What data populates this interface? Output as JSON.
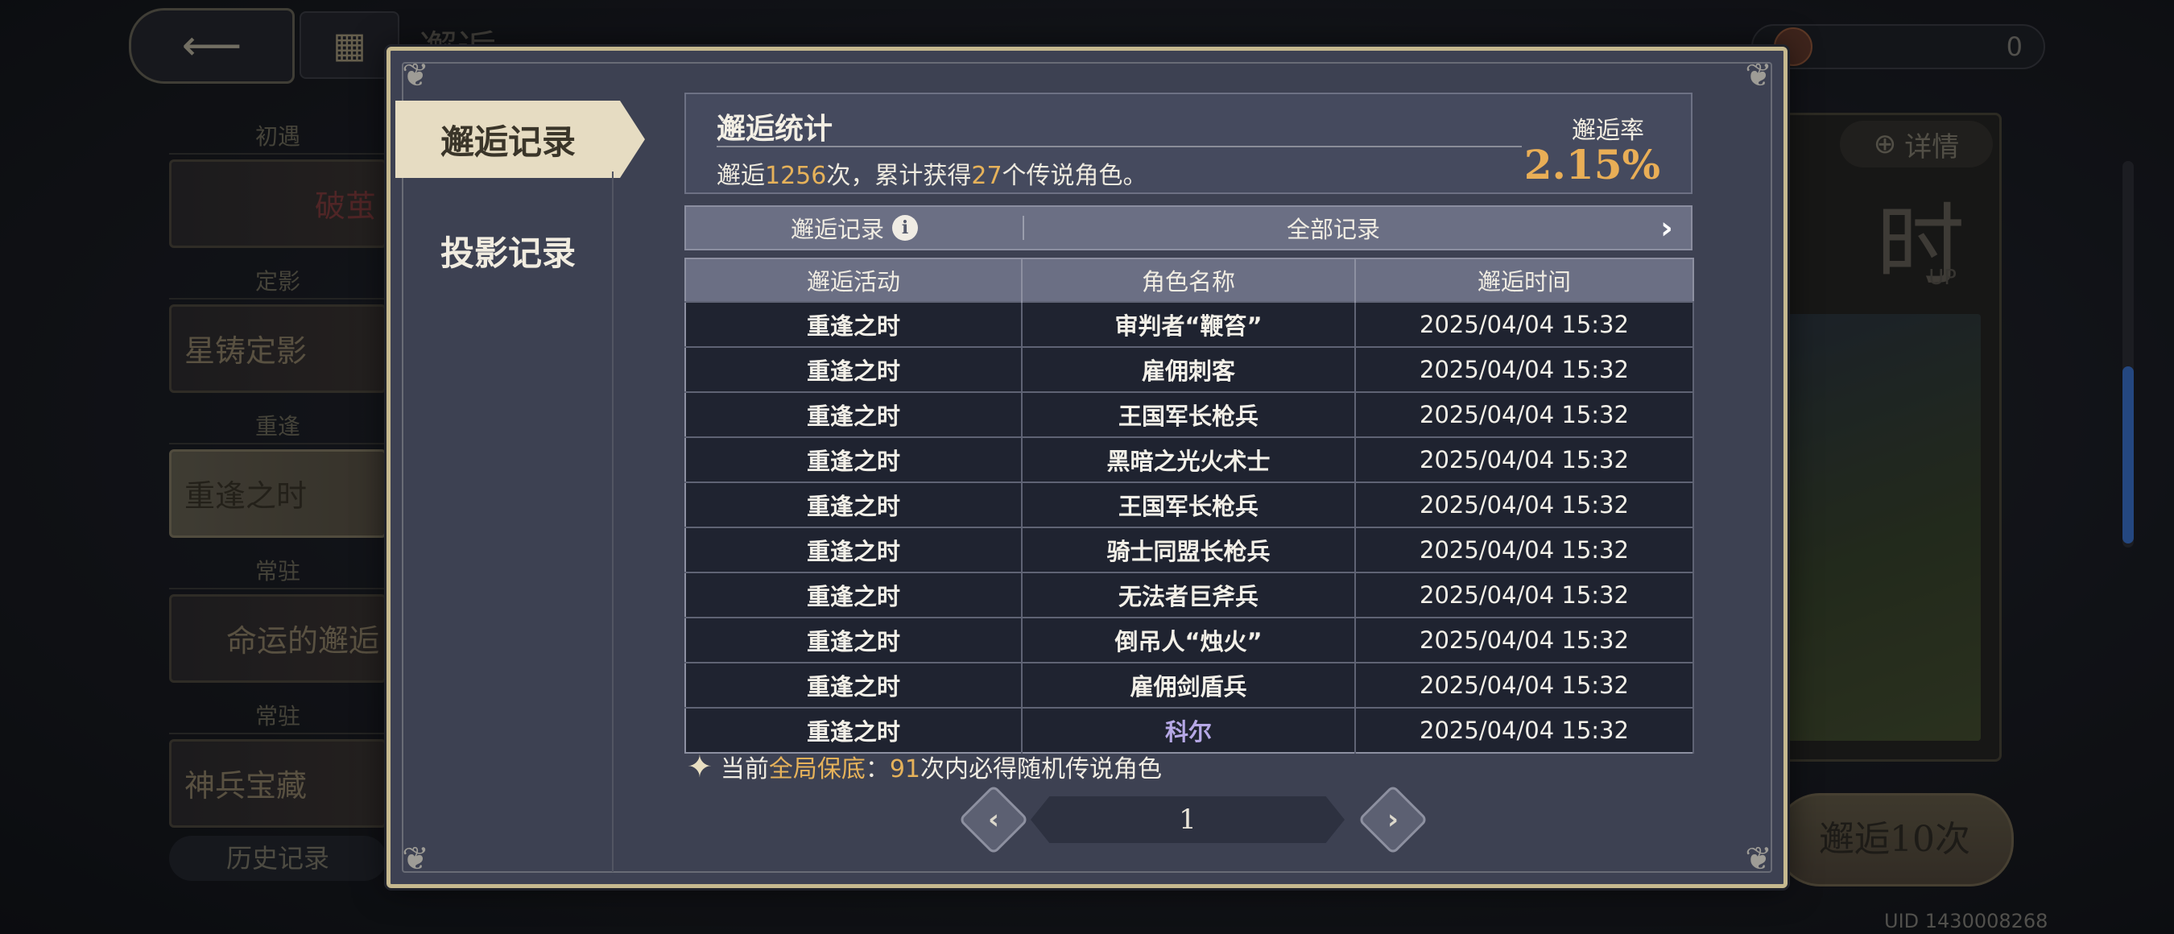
{
  "background": {
    "title": "邂逅",
    "currency_right_value": "0",
    "left_list": [
      {
        "category": "初遇",
        "label": "破茧"
      },
      {
        "category": "定影",
        "label": "星铸定影"
      },
      {
        "category": "重逢",
        "label": "重逢之时"
      },
      {
        "category": "常驻",
        "label": "命运的邂逅"
      },
      {
        "category": "常驻",
        "label": "神兵宝藏"
      }
    ],
    "history_button": "历史记录",
    "details_button": "详情",
    "banner_big_text": "时",
    "banner_sub_text": "UP",
    "summon_button": "邂逅10次",
    "uid": "UID 1430008268"
  },
  "modal": {
    "tabs": [
      {
        "label": "邂逅记录",
        "active": true
      },
      {
        "label": "投影记录",
        "active": false
      }
    ],
    "stats": {
      "title": "邂逅统计",
      "text_prefix": "邂逅",
      "count": "1256",
      "text_mid": "次，累计获得",
      "legend_count": "27",
      "text_suffix": "个传说角色。",
      "rate_label": "邂逅率",
      "rate_value": "2.15%"
    },
    "filter": {
      "left_label": "邂逅记录",
      "right_label": "全部记录"
    },
    "table": {
      "headers": [
        "邂逅活动",
        "角色名称",
        "邂逅时间"
      ],
      "rows": [
        {
          "activity": "重逢之时",
          "name": "审判者“鞭笞”",
          "time": "2025/04/04 15:32"
        },
        {
          "activity": "重逢之时",
          "name": "雇佣刺客",
          "time": "2025/04/04 15:32"
        },
        {
          "activity": "重逢之时",
          "name": "王国军长枪兵",
          "time": "2025/04/04 15:32"
        },
        {
          "activity": "重逢之时",
          "name": "黑暗之光火术士",
          "time": "2025/04/04 15:32"
        },
        {
          "activity": "重逢之时",
          "name": "王国军长枪兵",
          "time": "2025/04/04 15:32"
        },
        {
          "activity": "重逢之时",
          "name": "骑士同盟长枪兵",
          "time": "2025/04/04 15:32"
        },
        {
          "activity": "重逢之时",
          "name": "无法者巨斧兵",
          "time": "2025/04/04 15:32"
        },
        {
          "activity": "重逢之时",
          "name": "倒吊人“烛火”",
          "time": "2025/04/04 15:32"
        },
        {
          "activity": "重逢之时",
          "name": "雇佣剑盾兵",
          "time": "2025/04/04 15:32"
        },
        {
          "activity": "重逢之时",
          "name": "科尔",
          "time": "2025/04/04 15:32"
        }
      ]
    },
    "guarantee": {
      "prefix": "当前",
      "highlight": "全局保底",
      "colon": "：",
      "number": "91",
      "suffix": "次内必得随机传说角色"
    },
    "pagination": {
      "page": "1"
    }
  },
  "colors": {
    "accent_gold": "#e6b25a",
    "rare_name": "#b6a8e6",
    "modal_border": "#c6b98f"
  }
}
